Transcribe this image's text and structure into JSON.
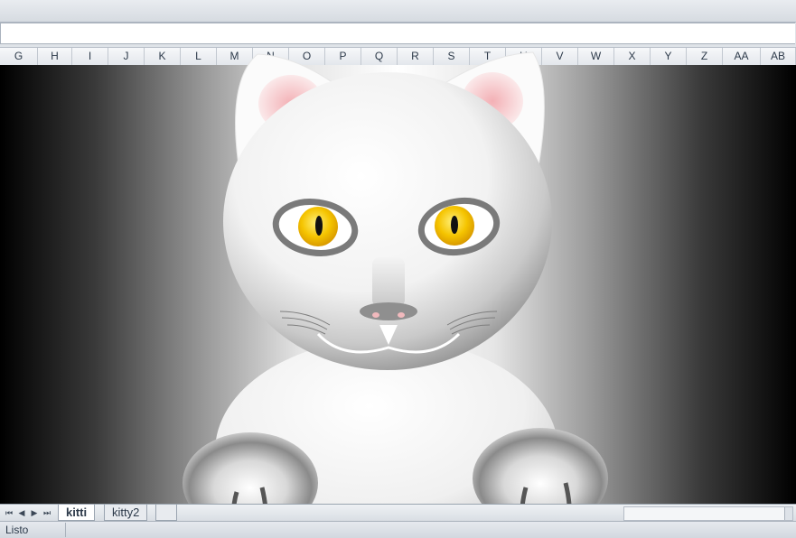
{
  "columns": [
    "G",
    "H",
    "I",
    "J",
    "K",
    "L",
    "M",
    "N",
    "O",
    "P",
    "Q",
    "R",
    "S",
    "T",
    "U",
    "V",
    "W",
    "X",
    "Y",
    "Z",
    "AA",
    "AB"
  ],
  "sheet_tabs": [
    {
      "label": "kitti",
      "active": true
    },
    {
      "label": "kitty2",
      "active": false
    }
  ],
  "status": {
    "text": "Listo"
  },
  "icons": {
    "first": "first-sheet-icon",
    "prev": "prev-sheet-icon",
    "next": "next-sheet-icon",
    "last": "last-sheet-icon",
    "insert": "insert-sheet-icon"
  },
  "colors": {
    "eye": "#f5c400",
    "pupil": "#111111",
    "ear_inner": "#f3b9bd",
    "nose": "#8f8f8f"
  }
}
